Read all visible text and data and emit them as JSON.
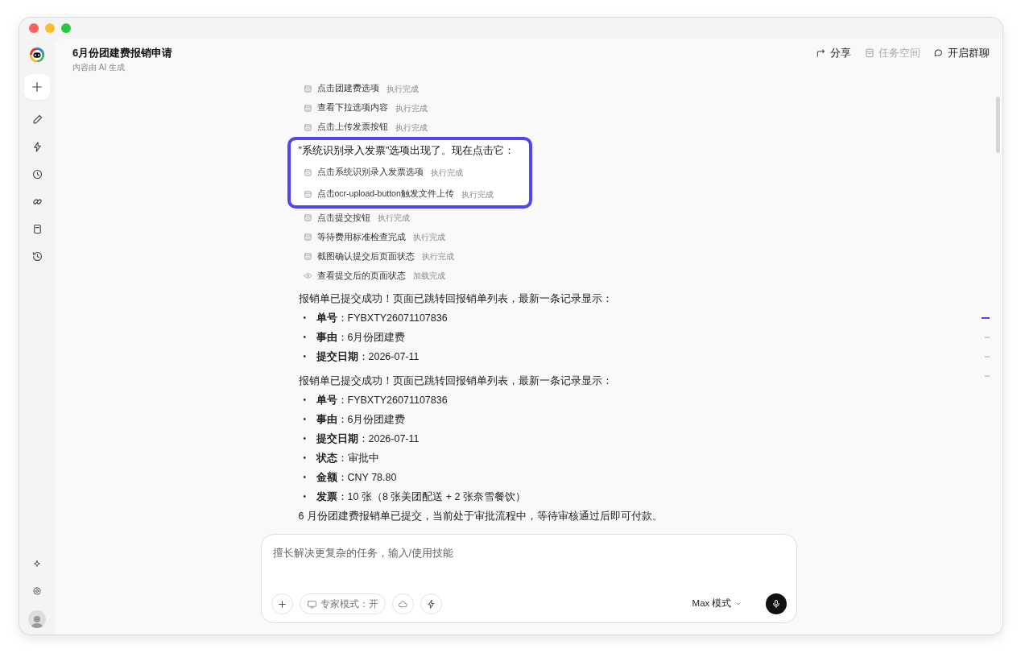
{
  "window": {
    "title": "6月份团建费报销申请",
    "subtitle": "内容由 AI 生成"
  },
  "header_actions": [
    {
      "label": "分享",
      "disabled": false
    },
    {
      "label": "任务空间",
      "disabled": true
    },
    {
      "label": "开启群聊",
      "disabled": false
    }
  ],
  "steps_before": [
    {
      "kind": "action",
      "text": "点击团建费选项",
      "status": "执行完成"
    },
    {
      "kind": "action",
      "text": "查看下拉选项内容",
      "status": "执行完成"
    },
    {
      "kind": "action",
      "text": "点击上传发票按钮",
      "status": "执行完成"
    }
  ],
  "highlight": {
    "heading": "\"系统识别录入发票\"选项出现了。现在点击它：",
    "steps": [
      {
        "kind": "action",
        "text": "点击系统识别录入发票选项",
        "status": "执行完成"
      },
      {
        "kind": "action",
        "text": "点击ocr-upload-button触发文件上传",
        "status": "执行完成"
      }
    ]
  },
  "steps_after": [
    {
      "kind": "action",
      "text": "点击提交按钮",
      "status": "执行完成"
    },
    {
      "kind": "action",
      "text": "等待费用标准检查完成",
      "status": "执行完成"
    },
    {
      "kind": "action",
      "text": "截图确认提交后页面状态",
      "status": "执行完成"
    },
    {
      "kind": "view",
      "text": "查看提交后的页面状态",
      "status": "加载完成"
    }
  ],
  "messages": [
    {
      "intro": "报销单已提交成功！页面已跳转回报销单列表，最新一条记录显示：",
      "items": [
        {
          "bullet": "•",
          "text": "**单号**：FYBXTY26071107836"
        },
        {
          "bullet": "•",
          "text": "**事由**：6月份团建费"
        },
        {
          "bullet": "•",
          "text": "**提交日期**：2026-07-11"
        }
      ]
    },
    {
      "intro": "报销单已提交成功！页面已跳转回报销单列表，最新一条记录显示：",
      "items": [
        {
          "bullet": "•",
          "text": "**单号**：FYBXTY26071107836"
        },
        {
          "bullet": "•",
          "text": "**事由**：6月份团建费"
        },
        {
          "bullet": "•",
          "text": "**提交日期**：2026-07-11"
        },
        {
          "bullet": "•",
          "text": "**状态**：审批中"
        },
        {
          "bullet": "•",
          "text": "**金额**：CNY 78.80"
        },
        {
          "bullet": "•",
          "text": "**发票**：10 张（8 张美团配送 + 2 张奈雪餐饮）"
        }
      ]
    }
  ],
  "closing": "6 月份团建费报销单已提交，当前处于审批流程中，等待审核通过后即可付款。",
  "toc_marks": [
    {
      "selected": true
    },
    {
      "selected": false
    },
    {
      "selected": false
    },
    {
      "selected": false
    }
  ],
  "composer": {
    "placeholder": "擅长解决更复杂的任务，输入/使用技能",
    "expert_mode": "专家模式：开",
    "mode": "Max 模式"
  }
}
